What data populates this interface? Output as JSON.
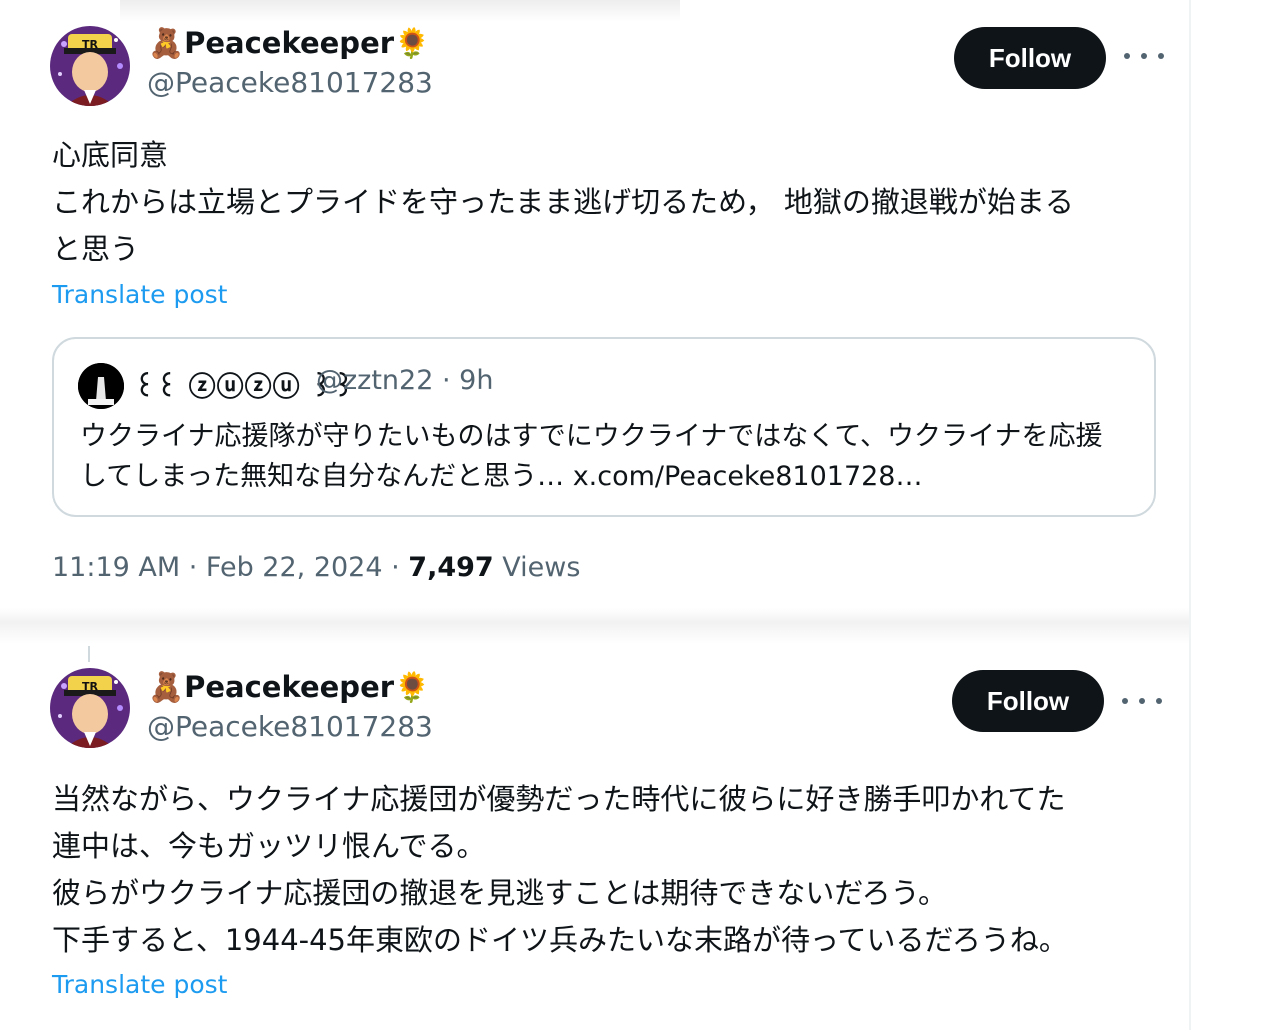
{
  "tweets": [
    {
      "name_prefix": "🧸",
      "name": "Peacekeeper",
      "name_suffix": "🌻",
      "handle": "@Peaceke81017283",
      "follow_label": "Follow",
      "text_lines": [
        "心底同意",
        "これからは立場とプライドを守ったまま逃げ切るため，  地獄の撤退戦が始まる",
        "と思う"
      ],
      "translate_label": "Translate post",
      "quote": {
        "name": "꒰꒰ ⓩⓤⓩⓤ ꒱꒱",
        "handle": "@zztn22",
        "time": "· 9h",
        "text_lines": [
          "ウクライナ応援隊が守りたいものはすでにウクライナではなくて、ウクライナを応援",
          "してしまった無知な自分なんだと思う… x.com/Peaceke8101728…"
        ]
      },
      "timestamp": "11:19 AM · Feb 22, 2024 · ",
      "views_count": "7,497",
      "views_label": " Views"
    },
    {
      "name_prefix": "🧸",
      "name": "Peacekeeper",
      "name_suffix": "🌻",
      "handle": "@Peaceke81017283",
      "follow_label": "Follow",
      "text_lines": [
        "当然ながら、ウクライナ応援団が優勢だった時代に彼らに好き勝手叩かれてた",
        "連中は、今もガッツリ恨んでる。",
        "彼らがウクライナ応援団の撤退を見逃すことは期待できないだろう。",
        "下手すると、1944-45年東欧のドイツ兵みたいな末路が待っているだろうね。"
      ],
      "translate_label": "Translate post"
    }
  ],
  "colors": {
    "text": "#0f1419",
    "secondary": "#536471",
    "link": "#1d9bf0",
    "follow_bg": "#0f1419",
    "border": "#cfd9de"
  },
  "icons": [
    "teddy-bear-icon",
    "sunflower-icon",
    "more-icon"
  ]
}
